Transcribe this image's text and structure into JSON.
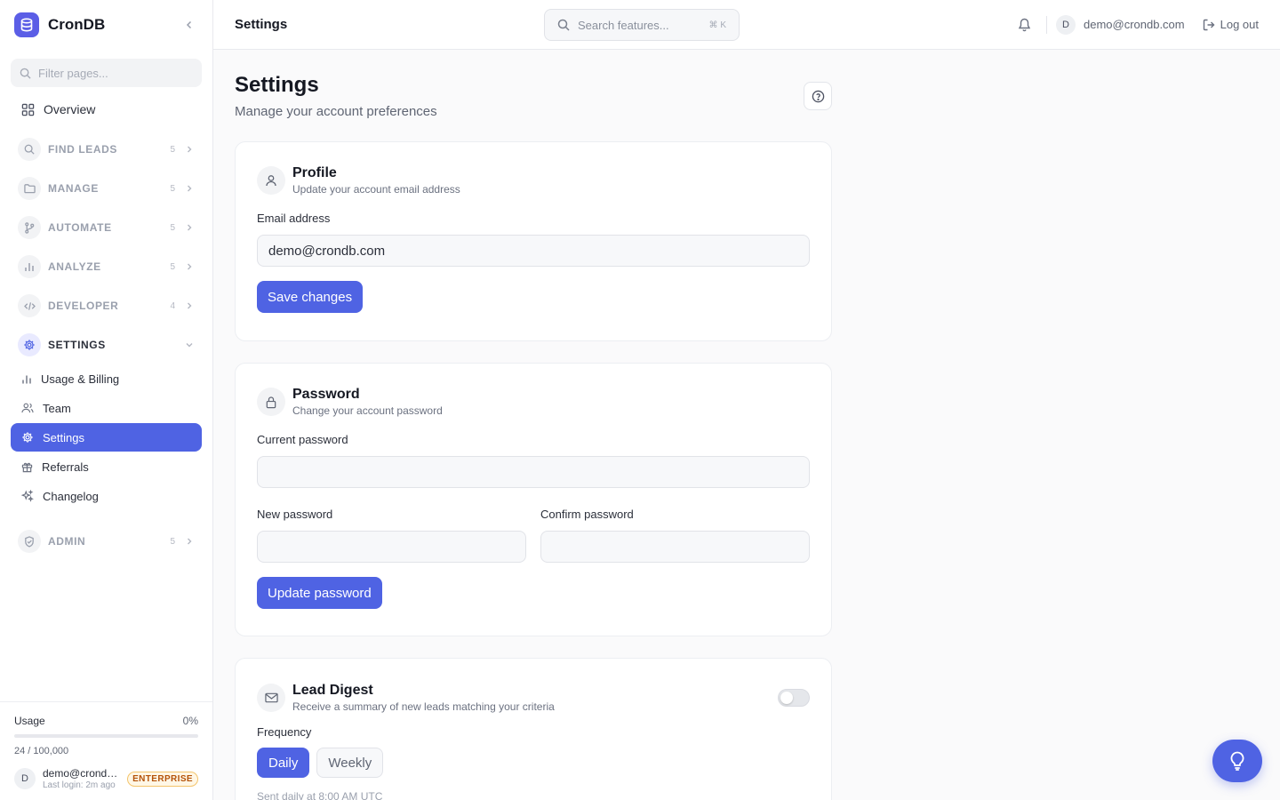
{
  "app": {
    "name": "CronDB"
  },
  "sidebar": {
    "filter_placeholder": "Filter pages...",
    "overview": "Overview",
    "sections": [
      {
        "label": "FIND LEADS",
        "count": "5",
        "icon": "search-icon"
      },
      {
        "label": "MANAGE",
        "count": "5",
        "icon": "folder-icon"
      },
      {
        "label": "AUTOMATE",
        "count": "5",
        "icon": "git-branch-icon"
      },
      {
        "label": "ANALYZE",
        "count": "5",
        "icon": "bar-chart-icon"
      },
      {
        "label": "DEVELOPER",
        "count": "4",
        "icon": "code-icon"
      }
    ],
    "settings_section": "SETTINGS",
    "settings_items": [
      {
        "label": "Usage & Billing",
        "icon": "bar-chart-icon"
      },
      {
        "label": "Team",
        "icon": "users-icon"
      },
      {
        "label": "Settings",
        "icon": "gear-icon",
        "active": true
      },
      {
        "label": "Referrals",
        "icon": "gift-icon"
      },
      {
        "label": "Changelog",
        "icon": "sparkles-icon"
      }
    ],
    "admin": {
      "label": "ADMIN",
      "count": "5",
      "icon": "shield-icon"
    },
    "footer": {
      "usage_label": "Usage",
      "usage_pct": "0%",
      "usage_fraction": 0.00024,
      "usage_count": "24 / 100,000",
      "user_initial": "D",
      "user_email": "demo@crondb.com",
      "last_login": "Last login: 2m ago",
      "plan_badge": "ENTERPRISE"
    }
  },
  "header": {
    "title": "Settings",
    "search_placeholder": "Search features...",
    "search_shortcut": "⌘ K",
    "user_initial": "D",
    "user_email": "demo@crondb.com",
    "logout": "Log out"
  },
  "page": {
    "title": "Settings",
    "subtitle": "Manage your account preferences"
  },
  "profile": {
    "title": "Profile",
    "desc": "Update your account email address",
    "email_label": "Email address",
    "email_value": "demo@crondb.com",
    "save": "Save changes"
  },
  "password": {
    "title": "Password",
    "desc": "Change your account password",
    "current_label": "Current password",
    "new_label": "New password",
    "confirm_label": "Confirm password",
    "update": "Update password"
  },
  "digest": {
    "title": "Lead Digest",
    "desc": "Receive a summary of new leads matching your criteria",
    "enabled": false,
    "frequency_label": "Frequency",
    "options": [
      "Daily",
      "Weekly"
    ],
    "selected": "Daily",
    "note": "Sent daily at 8:00 AM UTC"
  },
  "colors": {
    "accent": "#4f63e3",
    "brand": "#5b5ee6",
    "badge": "#b45309"
  }
}
